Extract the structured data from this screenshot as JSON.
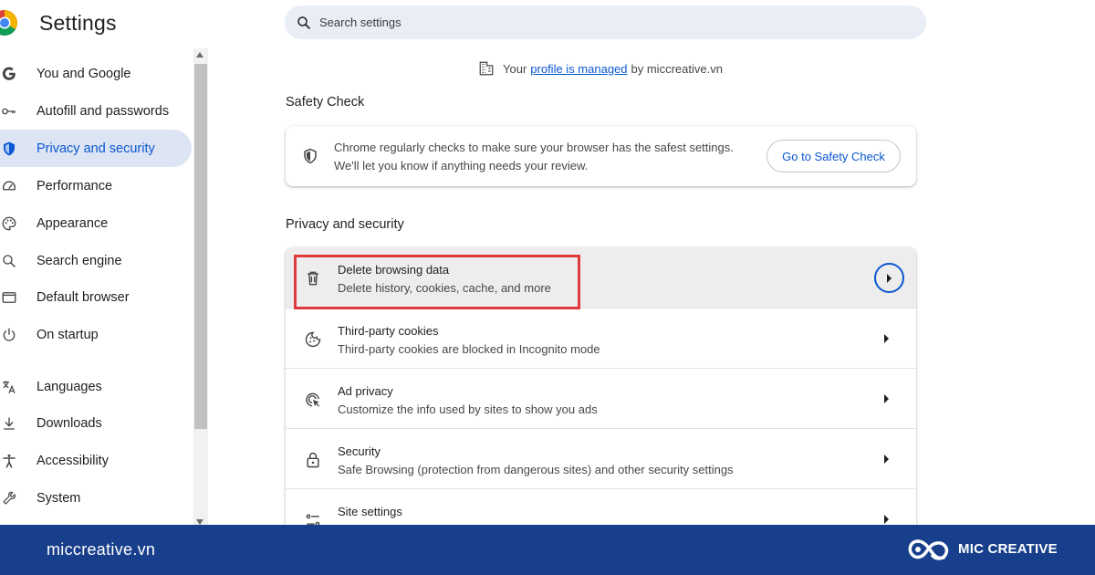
{
  "app": {
    "title": "Settings"
  },
  "search": {
    "placeholder": "Search settings"
  },
  "sidebar": {
    "items": [
      {
        "label": "You and Google",
        "icon": "google-icon"
      },
      {
        "label": "Autofill and passwords",
        "icon": "key-icon"
      },
      {
        "label": "Privacy and security",
        "icon": "shield-icon",
        "active": true
      },
      {
        "label": "Performance",
        "icon": "speedometer-icon"
      },
      {
        "label": "Appearance",
        "icon": "palette-icon"
      },
      {
        "label": "Search engine",
        "icon": "search-icon"
      },
      {
        "label": "Default browser",
        "icon": "browser-icon"
      },
      {
        "label": "On startup",
        "icon": "power-icon"
      },
      {
        "label": "Languages",
        "icon": "translate-icon"
      },
      {
        "label": "Downloads",
        "icon": "download-icon"
      },
      {
        "label": "Accessibility",
        "icon": "accessibility-icon"
      },
      {
        "label": "System",
        "icon": "wrench-icon"
      }
    ]
  },
  "managed": {
    "prefix": "Your",
    "link": "profile is managed",
    "suffix": "by miccreative.vn"
  },
  "safety": {
    "section_title": "Safety Check",
    "line1": "Chrome regularly checks to make sure your browser has the safest settings.",
    "line2": "We'll let you know if anything needs your review.",
    "button": "Go to Safety Check"
  },
  "privacy": {
    "section_title": "Privacy and security",
    "rows": [
      {
        "title": "Delete browsing data",
        "subtitle": "Delete history, cookies, cache, and more",
        "icon": "trash-icon"
      },
      {
        "title": "Third-party cookies",
        "subtitle": "Third-party cookies are blocked in Incognito mode",
        "icon": "cookie-icon"
      },
      {
        "title": "Ad privacy",
        "subtitle": "Customize the info used by sites to show you ads",
        "icon": "ad-privacy-icon"
      },
      {
        "title": "Security",
        "subtitle": "Safe Browsing (protection from dangerous sites) and other security settings",
        "icon": "lock-icon"
      },
      {
        "title": "Site settings",
        "subtitle": "",
        "icon": "tune-icon"
      }
    ]
  },
  "footer": {
    "site": "miccreative.vn",
    "brand": "MIC CREATIVE"
  },
  "colors": {
    "accent": "#0b57d0",
    "highlight": "#e03a3e",
    "footer_bg": "#183f8c",
    "active_nav_bg": "#dde5f5"
  }
}
